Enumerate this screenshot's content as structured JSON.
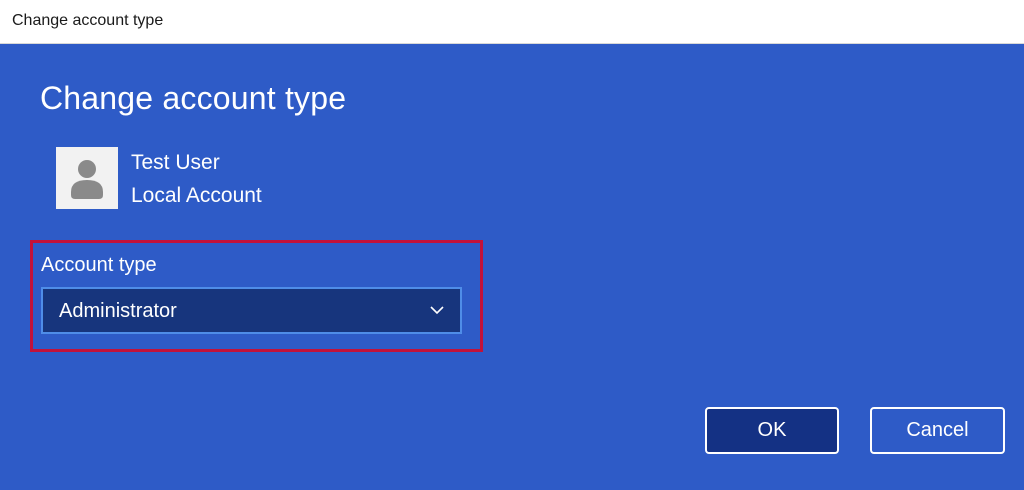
{
  "window": {
    "title": "Change account type"
  },
  "dialog": {
    "heading": "Change account type",
    "user": {
      "name": "Test User",
      "account_kind": "Local Account",
      "avatar_icon": "user-silhouette-icon"
    },
    "account_type": {
      "label": "Account type",
      "selected": "Administrator"
    },
    "buttons": {
      "ok": "OK",
      "cancel": "Cancel"
    }
  },
  "colors": {
    "background": "#2e5bc7",
    "dropdown_fill": "#17357d",
    "dropdown_border": "#4f8de8",
    "highlight": "#c2123b",
    "ok_fill": "#143184"
  }
}
